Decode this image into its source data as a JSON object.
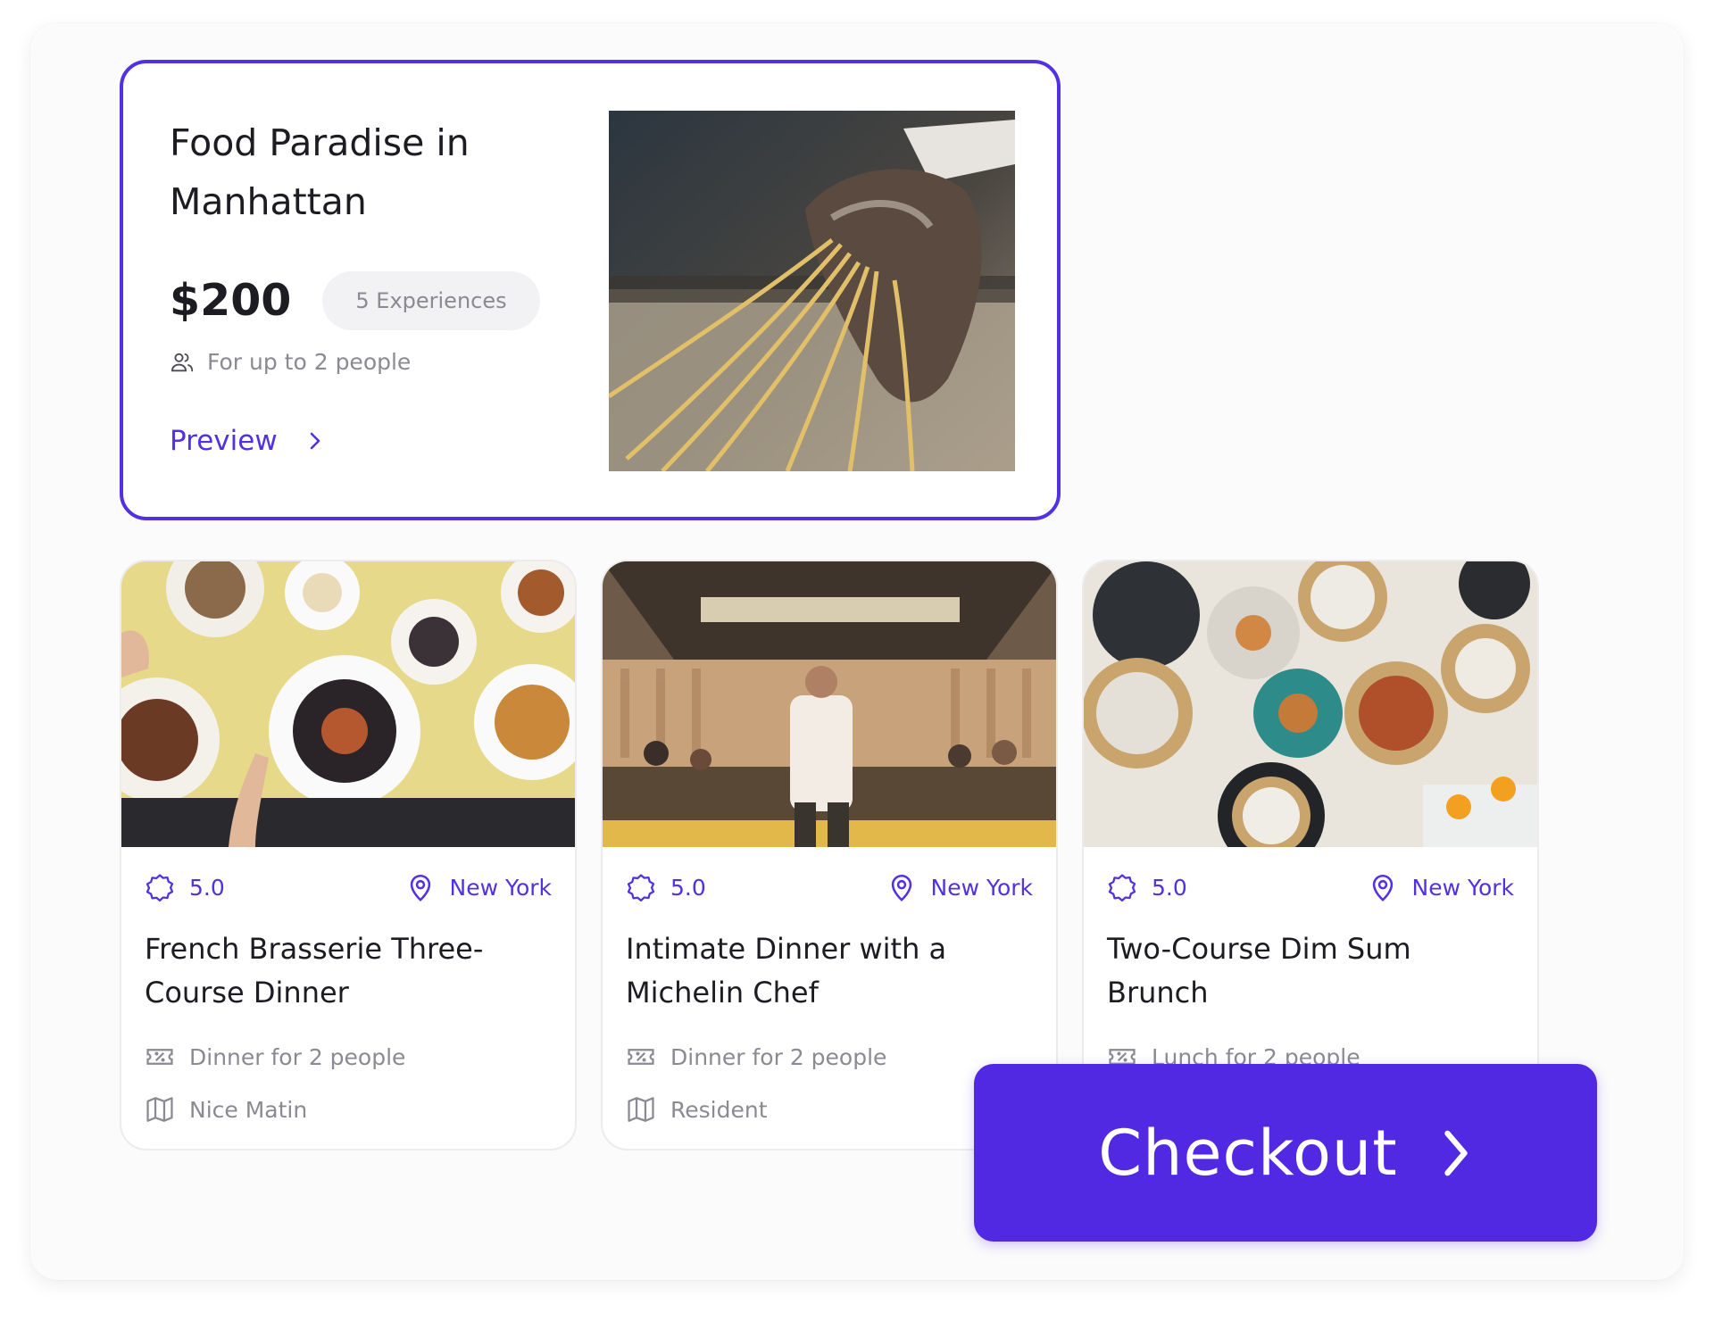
{
  "featured": {
    "title": "Food Paradise in Manhattan",
    "price": "$200",
    "experiences": "5 Experiences",
    "people": "For up to 2 people",
    "preview_label": "Preview"
  },
  "cards": [
    {
      "rating": "5.0",
      "location": "New York",
      "title": "French Brasserie Three-Course Dinner",
      "meal": "Dinner for 2 people",
      "venue": "Nice Matin"
    },
    {
      "rating": "5.0",
      "location": "New York",
      "title": "Intimate Dinner with a Michelin Chef",
      "meal": "Dinner for 2 people",
      "venue": "Resident"
    },
    {
      "rating": "5.0",
      "location": "New York",
      "title": "Two-Course Dim Sum Brunch",
      "meal": "Lunch for 2 people",
      "venue": ""
    }
  ],
  "checkout": {
    "label": "Checkout"
  },
  "colors": {
    "accent": "#5230e3",
    "checkout_bg": "#5229e3",
    "muted_text": "#8a8a92",
    "dark_text": "#1c1c22"
  },
  "icons": [
    "users-icon",
    "chevron-right-icon",
    "award-badge-icon",
    "map-pin-icon",
    "ticket-discount-icon",
    "map-icon"
  ]
}
